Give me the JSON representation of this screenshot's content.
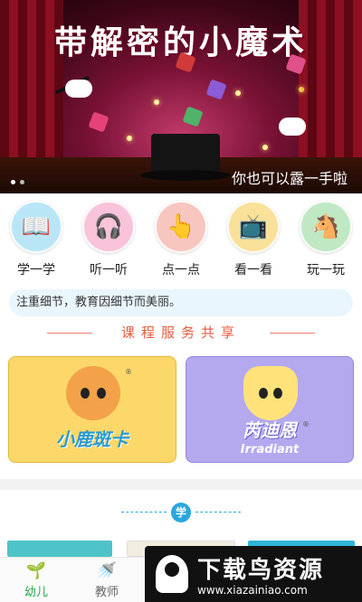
{
  "banner": {
    "title": "带解密的小魔术",
    "caption": "你也可以露一手啦",
    "pages": 2,
    "current_page": 1
  },
  "icons": [
    {
      "label": "学一学",
      "icon": "book-butterfly-icon",
      "glyph": "📖",
      "bg": "#b9e6f7"
    },
    {
      "label": "听一听",
      "icon": "headphones-icon",
      "glyph": "🎧",
      "bg": "#f9c3da"
    },
    {
      "label": "点一点",
      "icon": "tap-book-icon",
      "glyph": "👆",
      "bg": "#f7c6bf"
    },
    {
      "label": "看一看",
      "icon": "tv-play-icon",
      "glyph": "📺",
      "bg": "#f9e19a"
    },
    {
      "label": "玩一玩",
      "icon": "rocking-horse-icon",
      "glyph": "🐴",
      "bg": "#bfe8c3"
    }
  ],
  "motto": "注重细节，教育因细节而美丽。",
  "section_title": "课程服务共享",
  "courses": [
    {
      "brand": "小鹿斑卡",
      "sub": "",
      "icon": "deer-mascot-icon"
    },
    {
      "brand": "芮迪恩",
      "sub": "Irradiant",
      "icon": "star-mascot-icon"
    }
  ],
  "learn_badge": "学",
  "tabs": [
    {
      "label": "幼儿",
      "icon": "sprout-icon",
      "glyph": "🌱",
      "active": true
    },
    {
      "label": "教师",
      "icon": "watering-can-icon",
      "glyph": "🚿",
      "active": false
    }
  ],
  "watermark": {
    "title": "下载鸟资源",
    "url": "www.xiazainiao.com"
  }
}
